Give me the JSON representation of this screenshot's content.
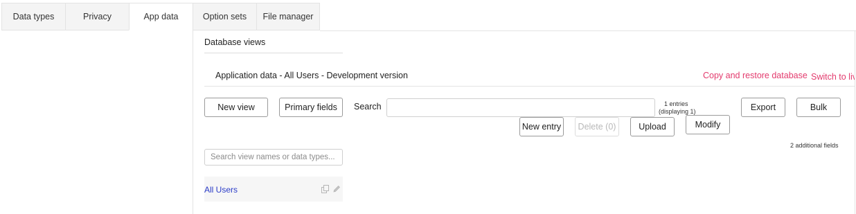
{
  "tabs": [
    {
      "label": "Data types"
    },
    {
      "label": "Privacy"
    },
    {
      "label": "App data"
    },
    {
      "label": "Option sets"
    },
    {
      "label": "File manager"
    }
  ],
  "section_title": "Database views",
  "app_data_title": "Application data - All Users - Development version",
  "links": {
    "copy_restore": "Copy and restore database",
    "switch_live": "Switch to live"
  },
  "buttons": {
    "new_view": "New view",
    "primary_fields": "Primary fields",
    "export": "Export",
    "bulk": "Bulk",
    "new_entry": "New entry",
    "delete": "Delete (0)",
    "upload": "Upload",
    "modify": "Modify"
  },
  "search": {
    "label": "Search",
    "value": "",
    "entries_count": "1 entries",
    "displaying": "(displaying 1)"
  },
  "additional_fields": "2 additional fields",
  "view_search": {
    "placeholder": "Search view names or data types..."
  },
  "views": [
    {
      "name": "All Users"
    }
  ],
  "colors": {
    "accent_link": "#e33a6d",
    "view_link": "#2b3cc8"
  }
}
